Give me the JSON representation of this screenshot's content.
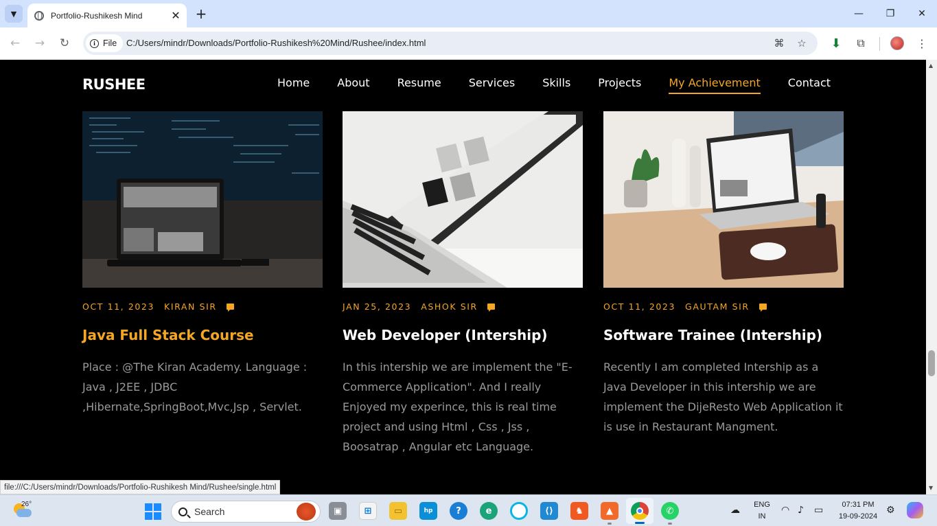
{
  "browser": {
    "tab_title": "Portfolio-Rushikesh Mind",
    "chip_label": "File",
    "url": "C:/Users/mindr/Downloads/Portfolio-Rushikesh%20Mind/Rushee/index.html",
    "status_url": "file:///C:/Users/mindr/Downloads/Portfolio-Rushikesh Mind/Rushee/single.html",
    "icons": [
      "tab-search-icon",
      "globe-icon",
      "close-icon",
      "plus-icon",
      "minimize-icon",
      "maximize-icon",
      "close-window-icon",
      "back-icon",
      "forward-icon",
      "reload-icon",
      "info-icon",
      "translate-icon",
      "star-icon",
      "download-icon",
      "extensions-icon",
      "avatar",
      "more-icon"
    ]
  },
  "site": {
    "logo": "RUSHEE",
    "nav": [
      "Home",
      "About",
      "Resume",
      "Services",
      "Skills",
      "Projects",
      "My Achievement",
      "Contact"
    ],
    "active_nav": "My Achievement",
    "accent_color": "#f5a623"
  },
  "cards": [
    {
      "date": "OCT 11, 2023",
      "author": "KIRAN SIR",
      "title": "Java Full Stack Course",
      "text": "Place : @The Kiran Academy. Language : Java , J2EE , JDBC ,Hibernate,SpringBoot,Mvc,Jsp , Servlet."
    },
    {
      "date": "JAN 25, 2023",
      "author": "ASHOK SIR",
      "title": "Web Developer (Intership)",
      "text": "In this intership we are implement the \"E-Commerce Application\". And I really Enjoyed my experince, this is real time project and using Html , Css , Jss , Boosatrap , Angular etc Language."
    },
    {
      "date": "OCT 11, 2023",
      "author": "GAUTAM SIR",
      "title": "Software Trainee (Intership)",
      "text": "Recently I am completed Intership as a Java Developer in this intership we are implement the DijeResto Web Application it is use in Restaurant Mangment."
    }
  ],
  "taskbar": {
    "temperature": "26°",
    "search_label": "Search",
    "lang_top": "ENG",
    "lang_bottom": "IN",
    "time": "07:31 PM",
    "date": "19-09-2024"
  }
}
